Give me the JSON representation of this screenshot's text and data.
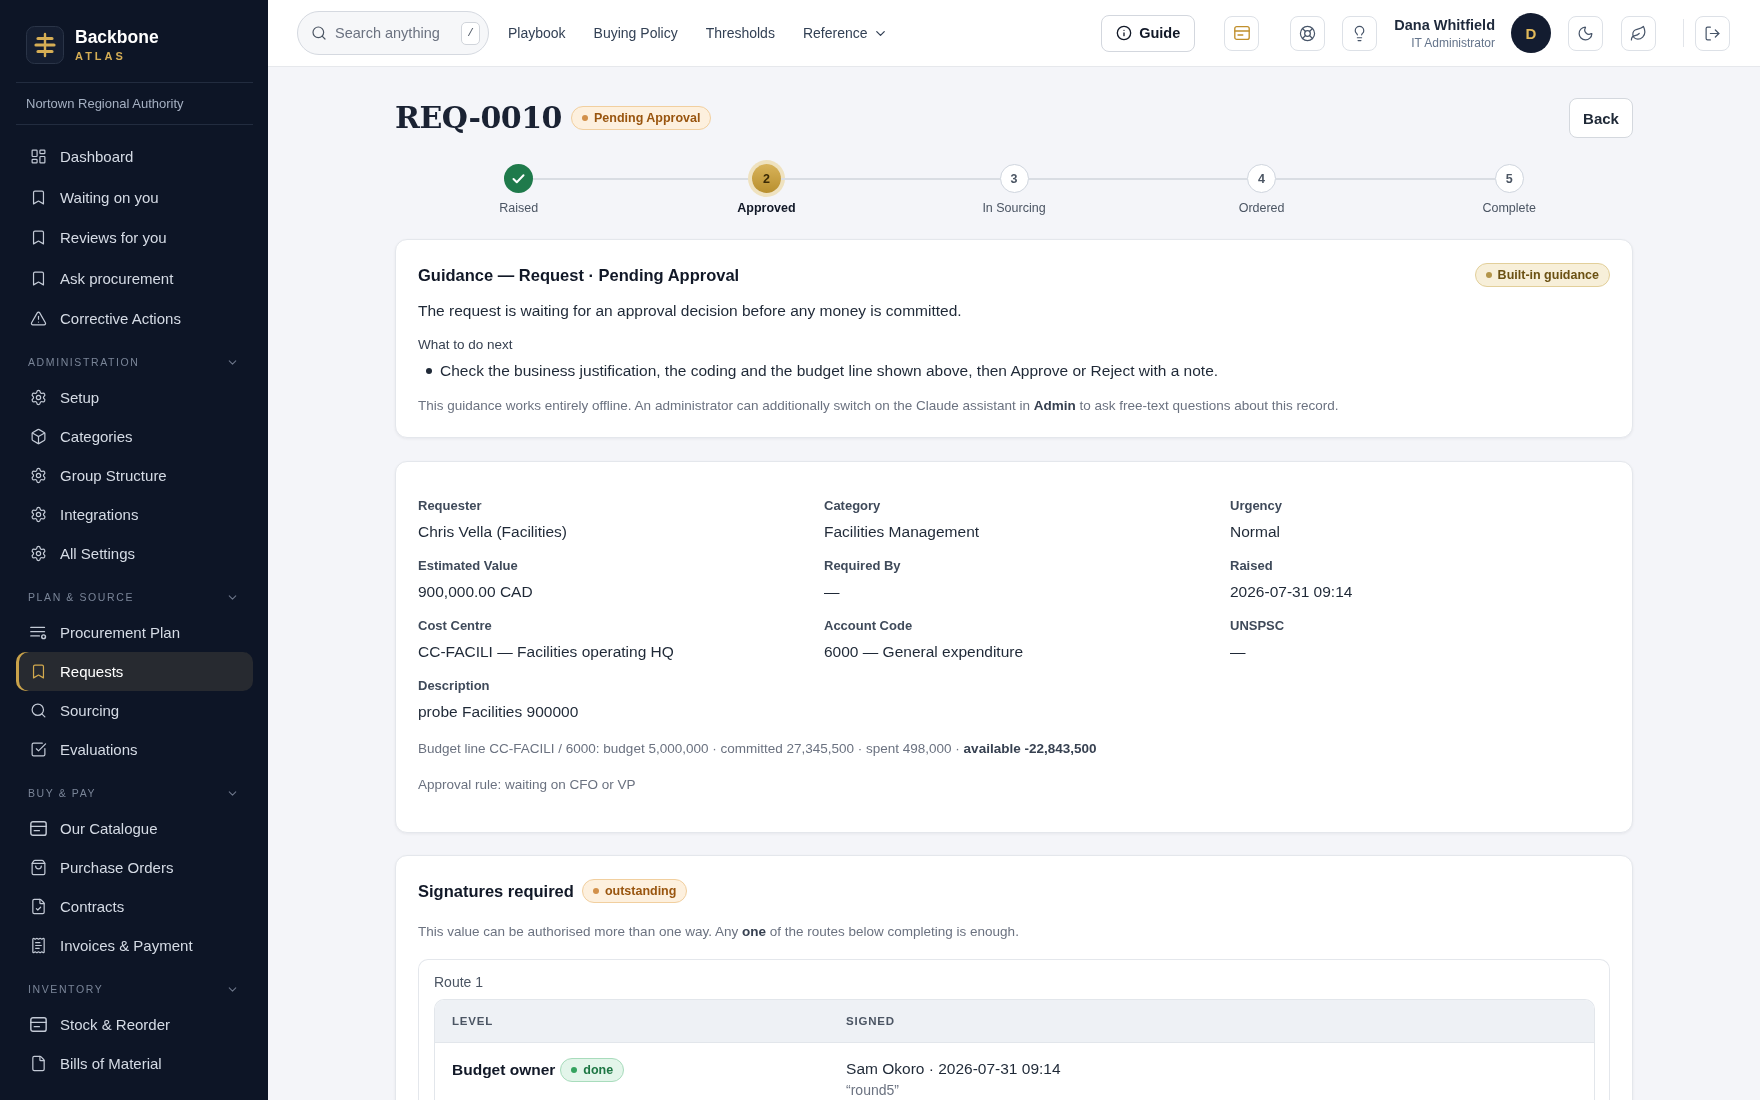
{
  "sidebar": {
    "brand": {
      "name": "Backbone",
      "tagline": "ATLAS"
    },
    "organisation": "Nortown Regional Authority",
    "items": [
      {
        "label": "Dashboard",
        "selected": false
      },
      {
        "label": "Waiting on you",
        "selected": false
      },
      {
        "label": "Reviews for you",
        "selected": false
      },
      {
        "label": "Ask procurement",
        "selected": false
      },
      {
        "label": "Corrective Actions",
        "selected": false
      }
    ],
    "sections": [
      {
        "title": "ADMINISTRATION",
        "expanded": true,
        "items": [
          {
            "label": "Setup",
            "selected": false
          },
          {
            "label": "Categories",
            "selected": false
          },
          {
            "label": "Group Structure",
            "selected": false
          },
          {
            "label": "Integrations",
            "selected": false
          },
          {
            "label": "All Settings",
            "selected": false
          }
        ]
      },
      {
        "title": "PLAN & SOURCE",
        "expanded": true,
        "items": [
          {
            "label": "Procurement Plan",
            "selected": false
          },
          {
            "label": "Requests",
            "selected": true
          },
          {
            "label": "Sourcing",
            "selected": false
          },
          {
            "label": "Evaluations",
            "selected": false
          }
        ]
      },
      {
        "title": "BUY & PAY",
        "expanded": true,
        "items": [
          {
            "label": "Our Catalogue",
            "selected": false
          },
          {
            "label": "Purchase Orders",
            "selected": false
          },
          {
            "label": "Contracts",
            "selected": false
          },
          {
            "label": "Invoices & Payment",
            "selected": false
          }
        ]
      },
      {
        "title": "INVENTORY",
        "expanded": true,
        "items": [
          {
            "label": "Stock & Reorder",
            "selected": false
          },
          {
            "label": "Bills of Material",
            "selected": false
          }
        ]
      }
    ]
  },
  "topbar": {
    "search": {
      "placeholder": "Search anything",
      "shortcut": "/"
    },
    "links": [
      {
        "label": "Playbook",
        "kind": "link"
      },
      {
        "label": "Buying Policy",
        "kind": "link"
      },
      {
        "label": "Thresholds",
        "kind": "link"
      },
      {
        "label": "Reference",
        "kind": "menu"
      }
    ],
    "guide_button": "Guide",
    "user": {
      "name": "Dana Whitfield",
      "role": "IT Administrator",
      "initial": "D"
    }
  },
  "record": {
    "title": "REQ-0010",
    "status": {
      "label": "Pending Approval",
      "kind": "warning"
    },
    "back_button": "Back",
    "steps": [
      {
        "label": "Raised",
        "done": true,
        "current": false
      },
      {
        "number": "2",
        "label": "Approved",
        "done": false,
        "current": true
      },
      {
        "number": "3",
        "label": "In Sourcing",
        "done": false,
        "current": false
      },
      {
        "number": "4",
        "label": "Ordered",
        "done": false,
        "current": false
      },
      {
        "number": "5",
        "label": "Complete",
        "done": false,
        "current": false
      }
    ]
  },
  "guidance": {
    "title": "Guidance — Request · Pending Approval",
    "badge": {
      "label": "Built-in guidance",
      "kind": "accent"
    },
    "summary": "The request is waiting for an approval decision before any money is committed.",
    "next_heading": "What to do next",
    "next_steps": [
      "Check the business justification, the coding and the budget line shown above, then Approve or Reject with a note."
    ],
    "note": "This guidance works entirely offline. An administrator can additionally switch on the Claude assistant in **Admin** to ask free-text questions about this record."
  },
  "details": {
    "fields": [
      {
        "label": "Requester",
        "value": "Chris Vella (Facilities)"
      },
      {
        "label": "Category",
        "value": "Facilities Management"
      },
      {
        "label": "Urgency",
        "value": "Normal"
      },
      {
        "label": "Estimated Value",
        "value": "900,000.00 CAD"
      },
      {
        "label": "Required By",
        "value": "—"
      },
      {
        "label": "Raised",
        "value": "2026-07-31 09:14"
      },
      {
        "label": "Cost Centre",
        "value": "CC-FACILI — Facilities operating HQ"
      },
      {
        "label": "Account Code",
        "value": "6000 — General expenditure"
      },
      {
        "label": "UNSPSC",
        "value": "—"
      },
      {
        "label": "Description",
        "value": "probe Facilities 900000"
      }
    ],
    "budget_line": "Budget line CC-FACILI / 6000: budget 5,000,000 · committed 27,345,500 · spent 498,000 · **available -22,843,500**",
    "approval_rule": "Approval rule: waiting on CFO or VP"
  },
  "signatures": {
    "title": "Signatures required",
    "status": {
      "label": "outstanding",
      "kind": "warning"
    },
    "note": "This value can be authorised more than one way. Any **one** of the routes below completing is enough.",
    "routes": [
      {
        "name": "Route 1",
        "columns": [
          "LEVEL",
          "SIGNED"
        ],
        "rows": [
          {
            "level": "Budget owner",
            "status": {
              "label": "done",
              "kind": "success"
            },
            "signed": "Sam Okoro · 2026-07-31 09:14",
            "comment": "“round5”"
          }
        ]
      }
    ]
  }
}
